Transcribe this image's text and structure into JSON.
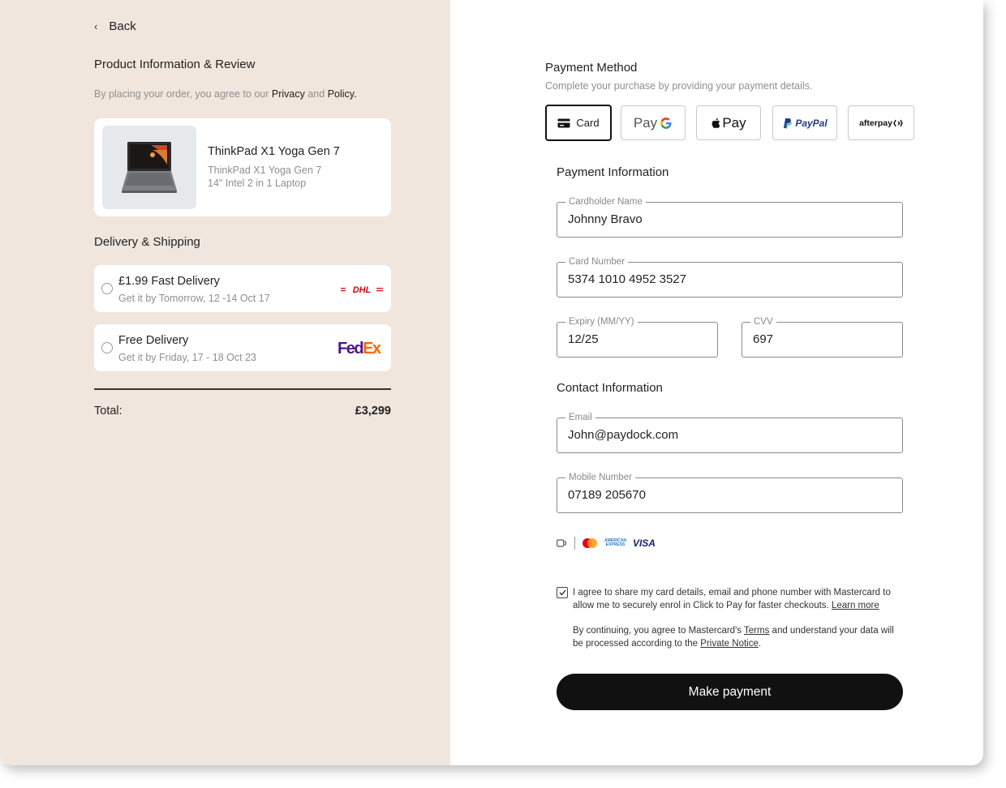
{
  "left": {
    "back_label": "Back",
    "product_heading": "Product Information & Review",
    "agree": {
      "prefix": "By placing your order, you agree to our",
      "privacy": "Privacy",
      "and": "and",
      "policy": "Policy."
    },
    "product": {
      "name": "ThinkPad X1 Yoga Gen 7",
      "desc_line1": "ThinkPad X1 Yoga Gen 7",
      "desc_line2": "14\" Intel 2 in 1 Laptop"
    },
    "delivery_heading": "Delivery & Shipping",
    "shipping": [
      {
        "title": "£1.99 Fast Delivery",
        "subtitle": "Get it by Tomorrow, 12 -14 Oct 17",
        "carrier": "DHL"
      },
      {
        "title": "Free Delivery",
        "subtitle": "Get it by Friday, 17 - 18 Oct 23",
        "carrier": "FedEx"
      }
    ],
    "total_label": "Total:",
    "total_value": "£3,299"
  },
  "right": {
    "payment_method_title": "Payment Method",
    "payment_method_subtitle": "Complete your purchase by providing your payment details.",
    "methods": {
      "card": "Card",
      "gpay": "Pay",
      "applepay": "Pay",
      "paypal": "PayPal",
      "afterpay": "afterpay"
    },
    "payment_info_title": "Payment Information",
    "fields": {
      "cardholder": {
        "label": "Cardholder Name",
        "value": "Johnny Bravo"
      },
      "card_number": {
        "label": "Card Number",
        "value": "5374 1010 4952 3527"
      },
      "expiry": {
        "label": "Expiry (MM/YY)",
        "value": "12/25"
      },
      "cvv": {
        "label": "CVV",
        "value": "697"
      },
      "email": {
        "label": "Email",
        "value": "John@paydock.com"
      },
      "mobile": {
        "label": "Mobile Number",
        "value": "07189 205670"
      }
    },
    "contact_info_title": "Contact Information",
    "card_brands": {
      "amex_line1": "AMERICAN",
      "amex_line2": "EXPRESS",
      "visa": "VISA"
    },
    "consent": {
      "text": "I agree to share my card details, email and phone number with Mastercard to allow me to securely enrol in Click to Pay for faster checkouts.",
      "learn_more": "Learn more",
      "continuing_prefix": "By continuing, you agree to Mastercard's",
      "terms": "Terms",
      "continuing_mid": "and understand your data will be processed according to the",
      "private_notice": "Private Notice",
      "period": "."
    },
    "make_payment": "Make payment",
    "colors": {
      "left_bg": "#f1e6de",
      "button": "#111111",
      "fedex_purple": "#4d148c",
      "fedex_orange": "#ff6200",
      "dhl_red": "#d40511",
      "paypal_blue": "#253b80"
    }
  }
}
